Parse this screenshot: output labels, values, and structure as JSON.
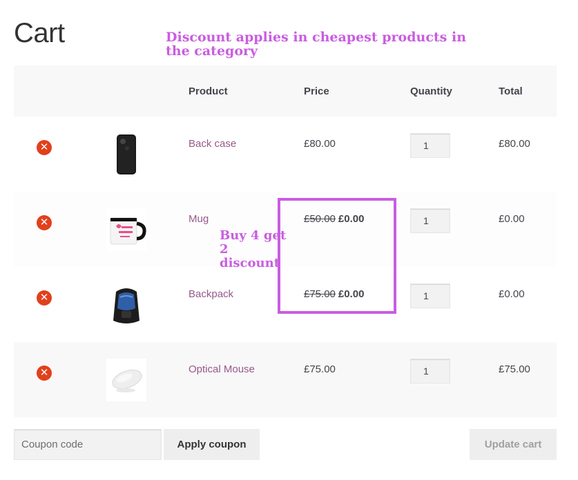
{
  "page_title": "Cart",
  "annotations": {
    "top": "Discount applies in cheapest products in the category",
    "mid": "Buy 4 get 2 discount"
  },
  "table": {
    "headers": {
      "product": "Product",
      "price": "Price",
      "quantity": "Quantity",
      "total": "Total"
    },
    "rows": [
      {
        "name": "Back case",
        "price": "£80.00",
        "old_price": "",
        "quantity": "1",
        "total": "£80.00"
      },
      {
        "name": "Mug",
        "price": "£0.00",
        "old_price": "£50.00",
        "quantity": "1",
        "total": "£0.00"
      },
      {
        "name": "Backpack",
        "price": "£0.00",
        "old_price": "£75.00",
        "quantity": "1",
        "total": "£0.00"
      },
      {
        "name": "Optical Mouse",
        "price": "£75.00",
        "old_price": "",
        "quantity": "1",
        "total": "£75.00"
      }
    ]
  },
  "coupon": {
    "placeholder": "Coupon code",
    "apply_label": "Apply coupon"
  },
  "update_label": "Update cart",
  "icons": {
    "remove": "remove-icon"
  },
  "colors": {
    "accent_link": "#96588a",
    "remove": "#e2401c",
    "annotation": "#c95de0"
  }
}
